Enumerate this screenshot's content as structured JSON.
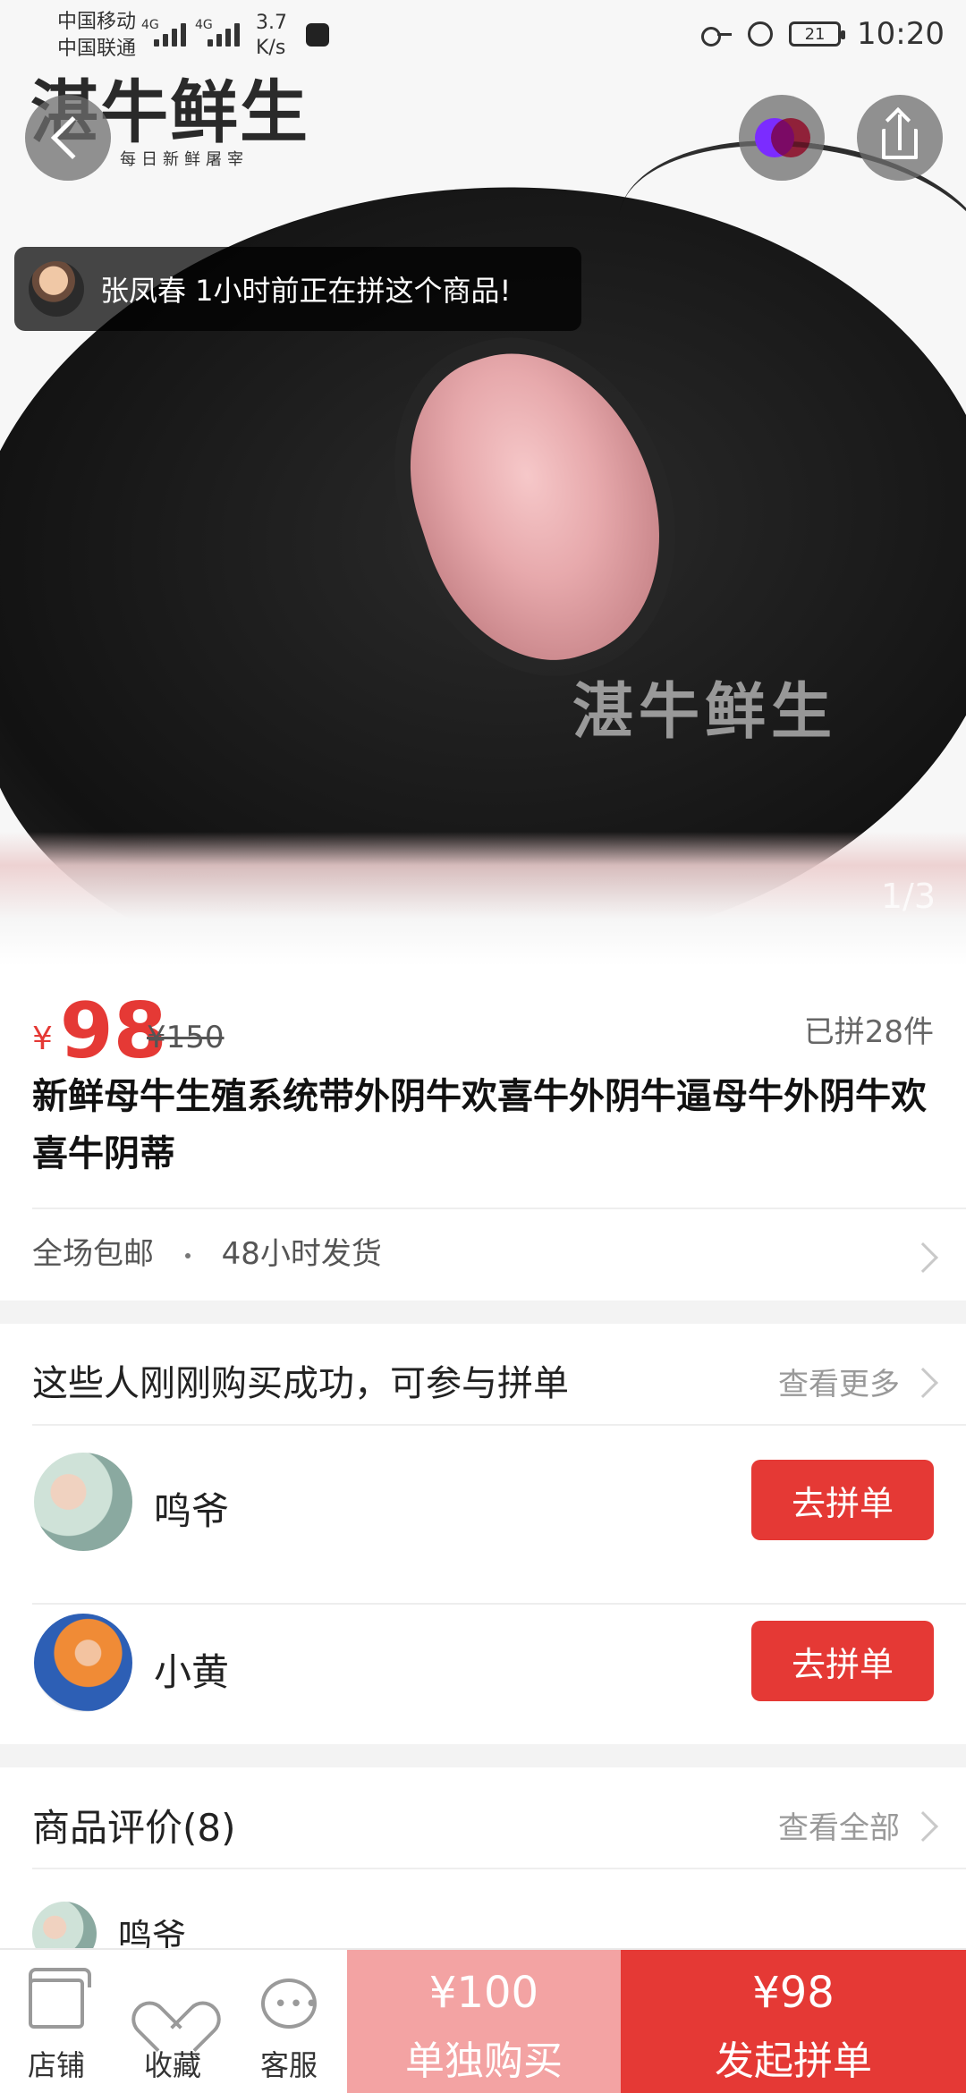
{
  "status_bar": {
    "carrier_1": "中国移动",
    "carrier_2": "中国联通",
    "network_1": "4G",
    "network_2": "4G",
    "speed": "3.7\nK/s",
    "battery": "21",
    "time": "10:20"
  },
  "brand": {
    "title": "湛牛鲜生",
    "subtitle": "每日新鲜屠宰"
  },
  "toast": {
    "text": "张凤春 1小时前正在拼这个商品!"
  },
  "hero": {
    "watermark": "湛牛鲜生",
    "counter": "1/3"
  },
  "product": {
    "currency": "¥",
    "price": "98",
    "original_price": "¥150",
    "sold": "已拼28件",
    "title": "新鲜母牛生殖系统带外阴牛欢喜牛外阴牛逼母牛外阴牛欢喜牛阴蒂",
    "shipping_1": "全场包邮",
    "shipping_2": "48小时发货"
  },
  "group": {
    "title": "这些人刚刚购买成功，可参与拼单",
    "more": "查看更多",
    "join_label": "去拼单",
    "rows": [
      {
        "name": "鸣爷"
      },
      {
        "name": "小黄"
      }
    ]
  },
  "review": {
    "title": "商品评价(8)",
    "more": "查看全部",
    "first_name": "鸣爷"
  },
  "bottom": {
    "store": "店铺",
    "favorite": "收藏",
    "service": "客服",
    "single_price": "¥100",
    "single_label": "单独购买",
    "group_price": "¥98",
    "group_label": "发起拼单"
  },
  "colors": {
    "accent_red": "#e53935",
    "light_red": "#f3a3a3"
  }
}
